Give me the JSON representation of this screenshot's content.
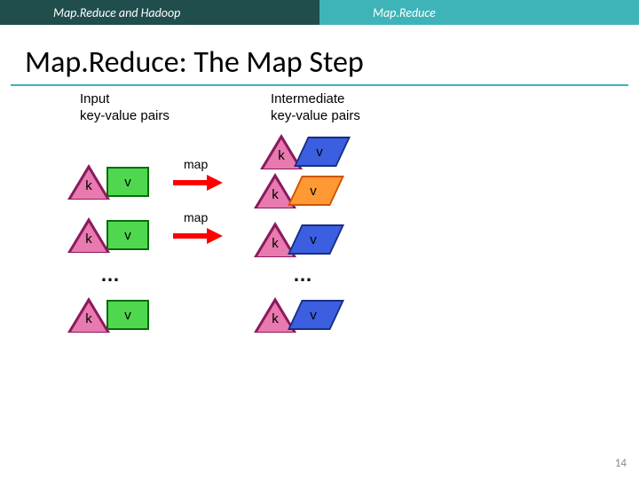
{
  "header": {
    "left": "Map.Reduce and Hadoop",
    "right": "Map.Reduce"
  },
  "title": "Map.Reduce: The Map Step",
  "labels": {
    "input": "Input\nkey-value pairs",
    "intermediate": "Intermediate\nkey-value pairs",
    "map": "map",
    "k": "k",
    "v": "v",
    "ellipsis": "…"
  },
  "page": "14"
}
